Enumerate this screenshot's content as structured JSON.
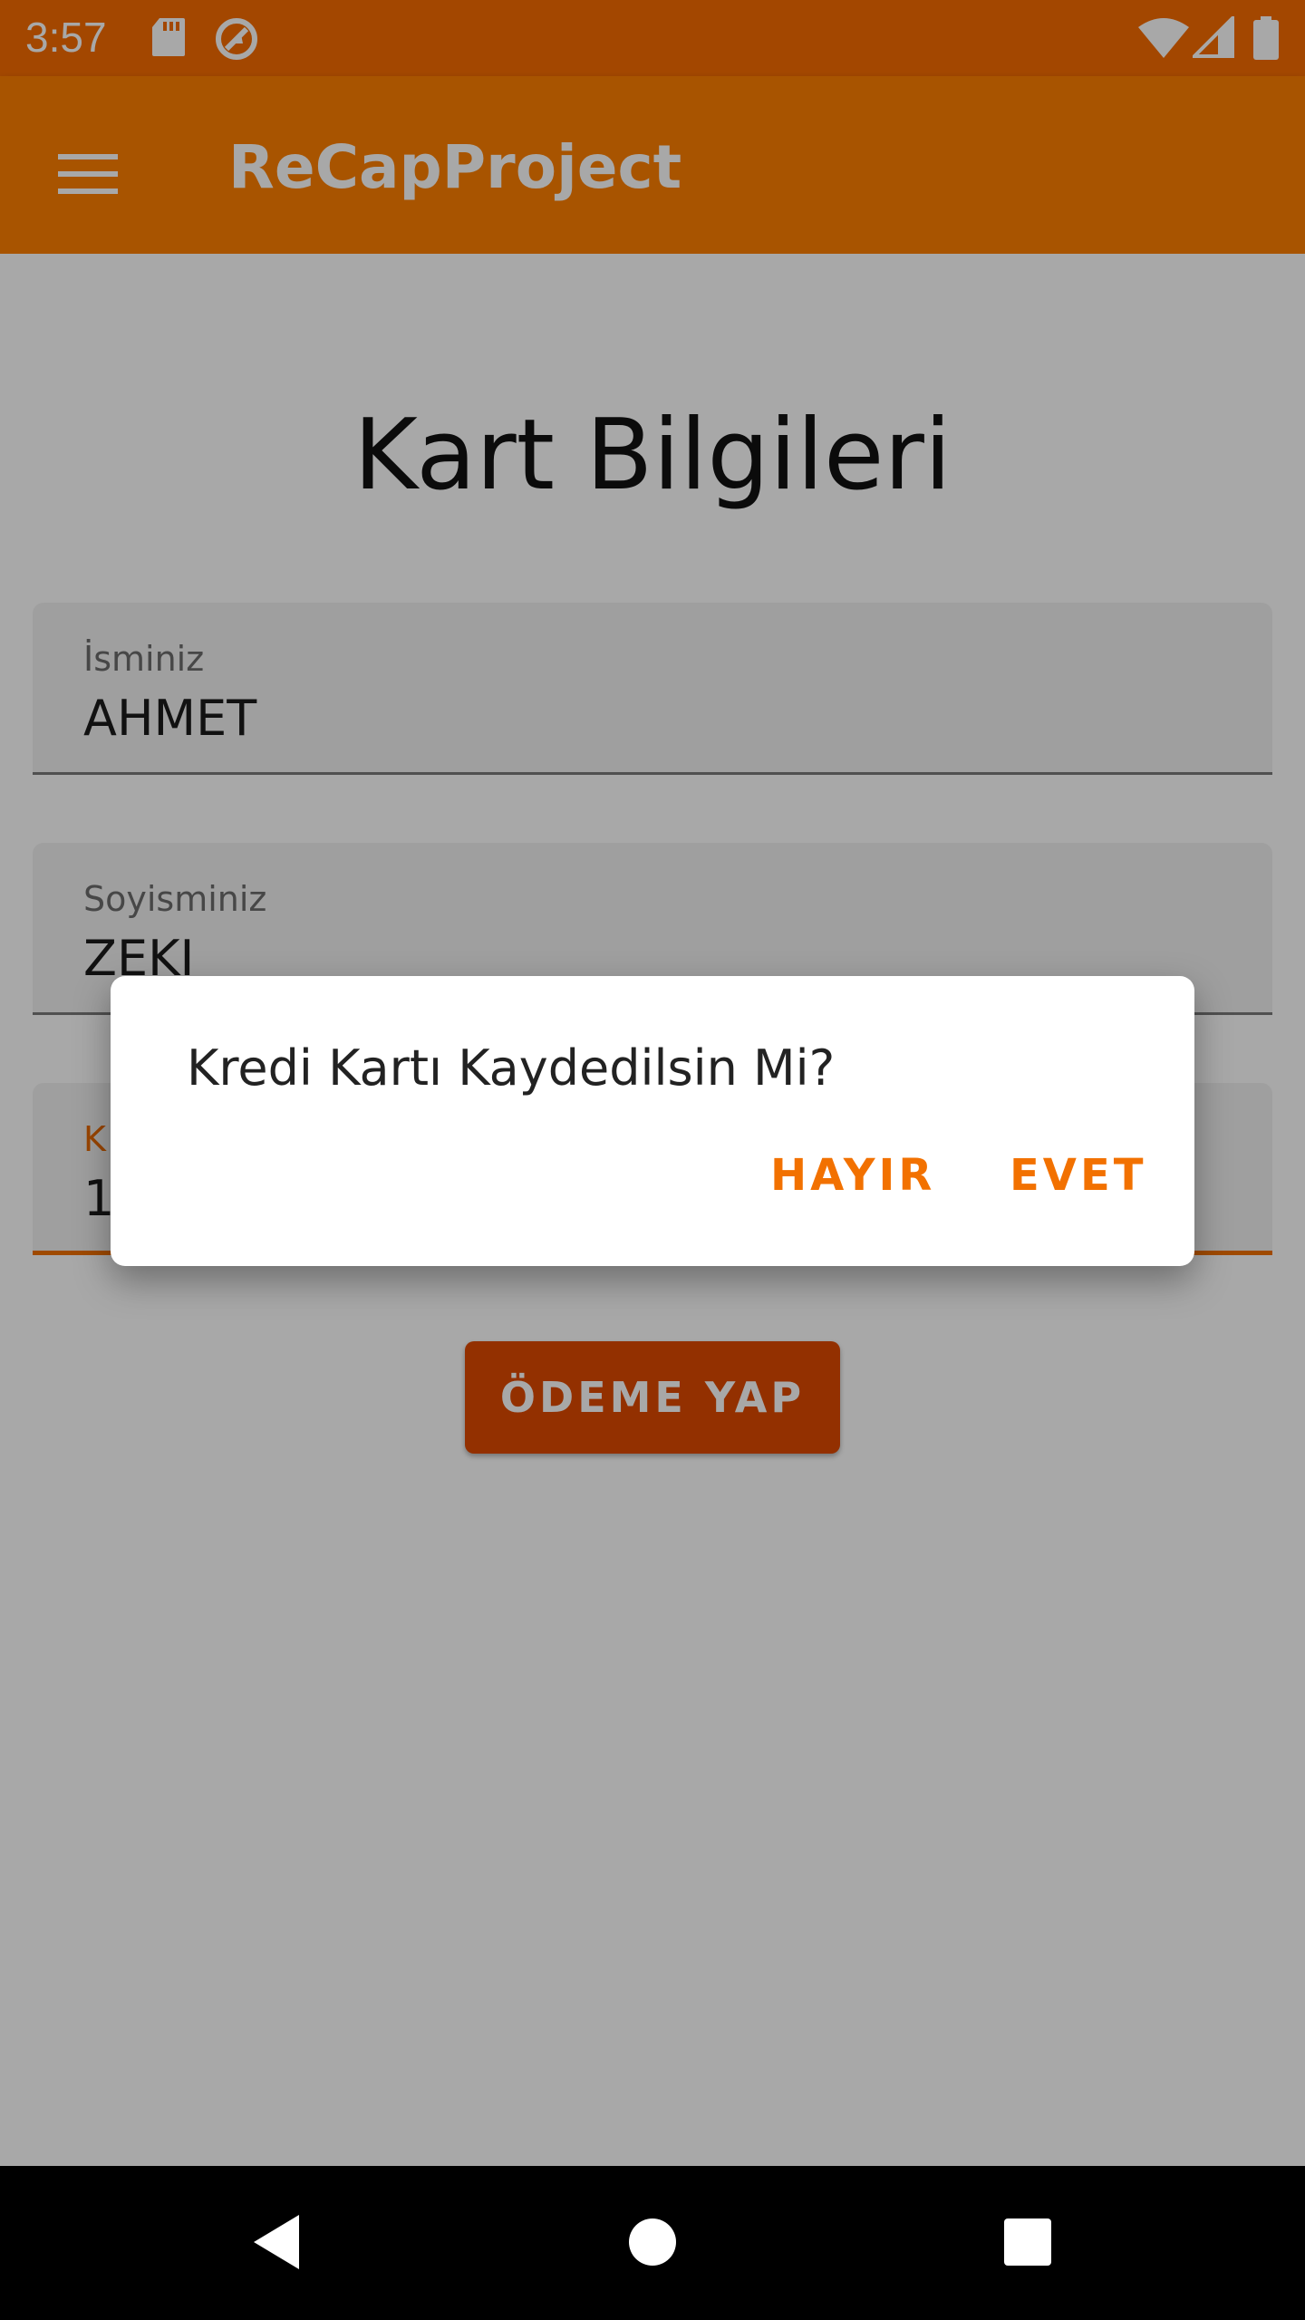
{
  "status_bar": {
    "time": "3:57",
    "icons": [
      "sd-card-icon",
      "sync-icon",
      "wifi-icon",
      "cell-signal-icon",
      "battery-icon"
    ]
  },
  "app_bar": {
    "menu_icon": "menu-icon",
    "title": "ReCapProject"
  },
  "page": {
    "heading": "Kart Bilgileri",
    "fields": [
      {
        "label": "İsminiz",
        "value": "AHMET"
      },
      {
        "label": "Soyisminiz",
        "value": "ZEKI"
      },
      {
        "label": "K",
        "value": "1"
      }
    ],
    "pay_button_label": "ÖDEME YAP"
  },
  "dialog": {
    "message": "Kredi Kartı Kaydedilsin Mi?",
    "no_label": "HAYIR",
    "yes_label": "EVET"
  },
  "nav_bar": {
    "icons": [
      "back-icon",
      "home-icon",
      "recents-icon"
    ]
  },
  "colors": {
    "status_bar": "#f76d00",
    "app_bar": "#ff8000",
    "accent": "#f27100",
    "button": "#e04a00"
  }
}
